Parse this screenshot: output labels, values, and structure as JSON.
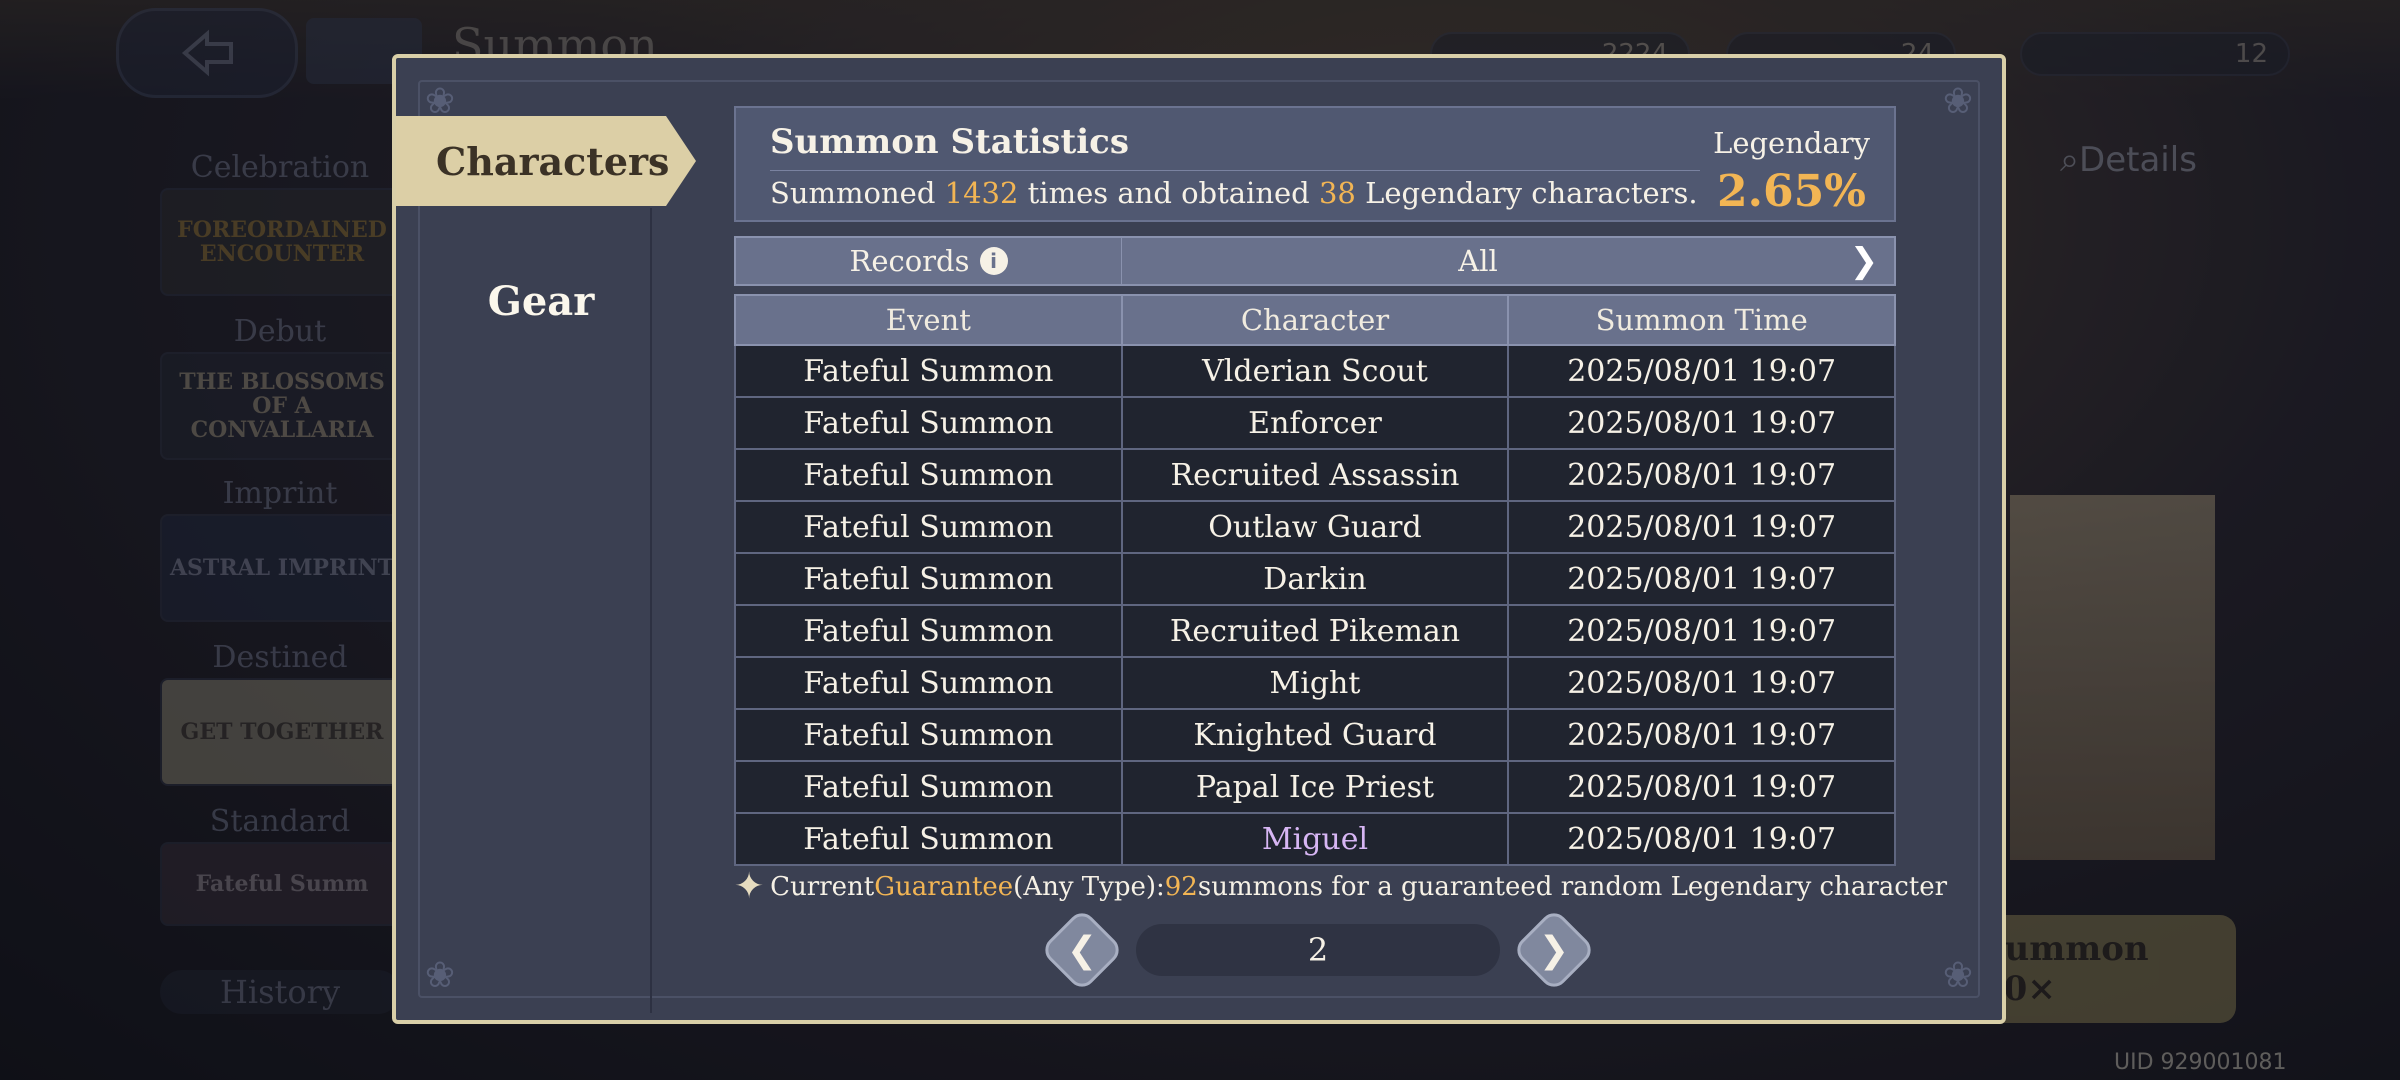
{
  "background": {
    "screen_title": "Summon",
    "currencies": [
      "2224",
      "24",
      "12"
    ],
    "categories": [
      "Celebration",
      "Debut",
      "Imprint",
      "Destined",
      "Standard"
    ],
    "banners": [
      "FOREORDAINED ENCOUNTER",
      "THE BLOSSOMS OF A CONVALLARIA",
      "ASTRAL IMPRINT",
      "GET TOGETHER",
      "Fateful Summ"
    ],
    "history_label": "History",
    "details_label": "Details",
    "summon_button_label": "Summon 10×",
    "uid": "UID 929001081"
  },
  "tabs": {
    "characters": "Characters",
    "gear": "Gear"
  },
  "stats": {
    "title": "Summon Statistics",
    "summoned_prefix": "Summoned ",
    "summon_count": "1432",
    "mid_text": " times and obtained ",
    "legendary_count": "38",
    "suffix": " Legendary characters.",
    "legendary_label": "Legendary",
    "legendary_rate": "2.65%"
  },
  "filter": {
    "records_label": "Records",
    "info_icon": "info-icon",
    "value": "All",
    "arrow_icon": "chevron-right-icon"
  },
  "table": {
    "headers": [
      "Event",
      "Character",
      "Summon Time"
    ],
    "rows": [
      {
        "event": "Fateful Summon",
        "character": "Vlderian Scout",
        "time": "2025/08/01 19:07"
      },
      {
        "event": "Fateful Summon",
        "character": "Enforcer",
        "time": "2025/08/01 19:07"
      },
      {
        "event": "Fateful Summon",
        "character": "Recruited Assassin",
        "time": "2025/08/01 19:07"
      },
      {
        "event": "Fateful Summon",
        "character": "Outlaw Guard",
        "time": "2025/08/01 19:07"
      },
      {
        "event": "Fateful Summon",
        "character": "Darkin",
        "time": "2025/08/01 19:07"
      },
      {
        "event": "Fateful Summon",
        "character": "Recruited Pikeman",
        "time": "2025/08/01 19:07"
      },
      {
        "event": "Fateful Summon",
        "character": "Might",
        "time": "2025/08/01 19:07"
      },
      {
        "event": "Fateful Summon",
        "character": "Knighted Guard",
        "time": "2025/08/01 19:07"
      },
      {
        "event": "Fateful Summon",
        "character": "Papal Ice Priest",
        "time": "2025/08/01 19:07"
      },
      {
        "event": "Fateful Summon",
        "character": "Miguel",
        "time": "2025/08/01 19:07"
      }
    ]
  },
  "guarantee": {
    "prefix": "Current ",
    "keyword": "Guarantee",
    "type_text": " (Any Type): ",
    "count": "92",
    "suffix": " summons for a guaranteed random Legendary character"
  },
  "pager": {
    "page": "2",
    "prev_icon": "chevron-left-icon",
    "next_icon": "chevron-right-icon"
  },
  "colors": {
    "accent_gold": "#f2b554",
    "legendary_name": "#d7b6f4",
    "modal_border": "#d9cfa8",
    "tab_active": "#dccfa6"
  }
}
